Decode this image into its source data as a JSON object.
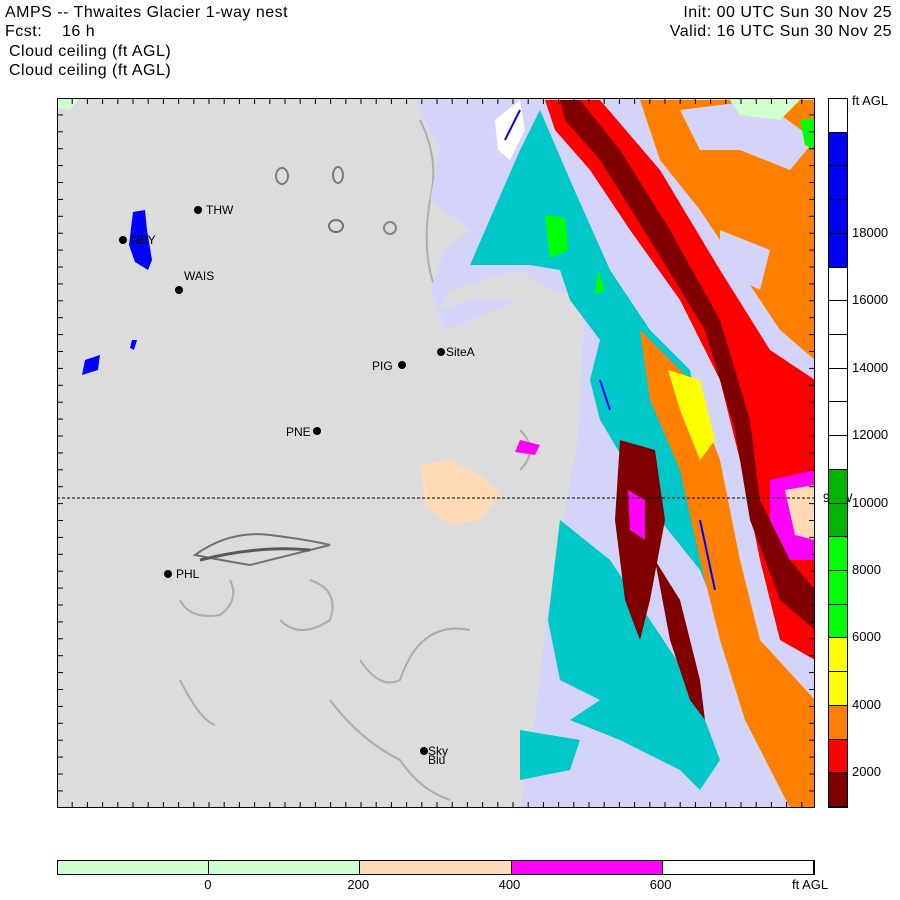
{
  "header": {
    "title": "AMPS -- Thwaites Glacier 1-way nest",
    "forecast": "Fcst:    16 h",
    "field_line1": "Cloud ceiling (ft AGL)",
    "field_line2": "Cloud ceiling (ft AGL)",
    "init": "Init: 00 UTC Sun 30 Nov 25",
    "valid": "Valid: 16 UTC Sun 30 Nov 25"
  },
  "map": {
    "meridian_label": "90 W",
    "stations": [
      {
        "name": "THW"
      },
      {
        "name": "NBY"
      },
      {
        "name": "WAIS"
      },
      {
        "name": "PIG"
      },
      {
        "name": "SiteA"
      },
      {
        "name": "PNE"
      },
      {
        "name": "PHL"
      },
      {
        "name": "Sky"
      },
      {
        "name": "Blu"
      }
    ],
    "colors": {
      "terrain": "#dcdcdc",
      "lavender": "#d4d4fa",
      "cyan": "#00c8c8",
      "blue": "#0000ff",
      "maroon": "#800000",
      "red": "#ff0000",
      "orange": "#ff8000",
      "yellow": "#ffff00",
      "green": "#00ff00",
      "darkgreen": "#00b400",
      "magenta": "#ff00ff",
      "peach": "#ffdab4",
      "lightgreen": "#d0ffd0"
    }
  },
  "vertical_colorbar": {
    "units": "ft AGL",
    "cells_top_to_bottom": [
      "#ffffff",
      "#0000ff",
      "#0000ff",
      "#0000ff",
      "#0000ff",
      "#ffffff",
      "#ffffff",
      "#ffffff",
      "#ffffff",
      "#ffffff",
      "#ffffff",
      "#00b400",
      "#00b400",
      "#00ff00",
      "#00ff00",
      "#00ff00",
      "#ffff00",
      "#ffff00",
      "#ff8000",
      "#ff0000",
      "#800000"
    ],
    "labels": [
      "18000",
      "16000",
      "14000",
      "12000",
      "10000",
      "8000",
      "6000",
      "4000",
      "2000"
    ]
  },
  "horizontal_colorbar": {
    "units": "ft AGL",
    "cells": [
      "#d0ffd0",
      "#d0ffd0",
      "#ffdab4",
      "#ff00ff",
      "#ffffff"
    ],
    "labels": [
      "0",
      "200",
      "400",
      "600"
    ]
  }
}
